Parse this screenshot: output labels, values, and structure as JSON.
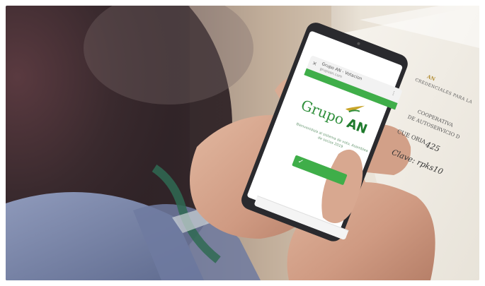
{
  "photo": {
    "subject": "hands-holding-smartphone",
    "colors": {
      "brand_green": "#3fae49",
      "logo_green": "#1e7a2c",
      "paper": "#f4f1ea",
      "sleeve": "#7b86a8"
    }
  },
  "phone": {
    "url_text": "Grupo AN - Votacion",
    "url_sub": "grupoan.com",
    "close_icon": "×",
    "action_icons": "⋮",
    "logo_word": "Grupo",
    "logo_mark": "AN",
    "blurb": "Bienvenido/a al sistema de voto. Asamblea de socios 2019",
    "button_icon": "check-icon"
  },
  "paper": {
    "logo": "AN",
    "heading": "CREDENCIALES PARA LA",
    "line1": "COOPERATIVA",
    "line2": "DE AUTOSERVICIO D",
    "cue_label": "CUE ORIA",
    "cue_value": "425",
    "code": "Clave: rpks10"
  }
}
